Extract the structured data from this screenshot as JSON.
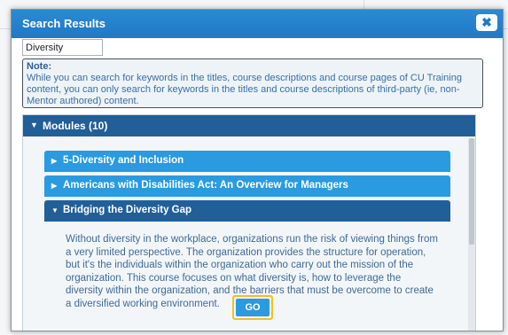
{
  "dialog": {
    "title": "Search Results",
    "close_icon": "close-icon",
    "close_glyph": "✖"
  },
  "search": {
    "value": "Diversity"
  },
  "note": {
    "label": "Note:",
    "text": "While you can search for keywords in the titles, course descriptions and course pages of CU Training content, you can only search for keywords in the titles and course descriptions of third-party (ie, non-Mentor authored) content."
  },
  "modules": {
    "header": "Modules (10)",
    "items": [
      {
        "label": "5-Diversity and Inclusion",
        "expanded": false
      },
      {
        "label": "Americans with Disabilities Act: An Overview for Managers",
        "expanded": false
      },
      {
        "label": "Bridging the Diversity Gap",
        "expanded": true
      }
    ],
    "active_description": "Without diversity in the workplace, organizations run the risk of viewing things from a very limited perspective. The organization provides the structure for operation, but it's the individuals within the organization who carry out the mission of the organization. This course focuses on what diversity is, how to leverage the diversity within the organization, and the barriers that must be overcome to create a diversified working environment.",
    "go_label": "GO"
  },
  "colors": {
    "header_blue": "#1f79c4",
    "item_blue": "#2a9be0",
    "active_blue": "#215f99",
    "highlight_yellow": "#f3c11a"
  }
}
